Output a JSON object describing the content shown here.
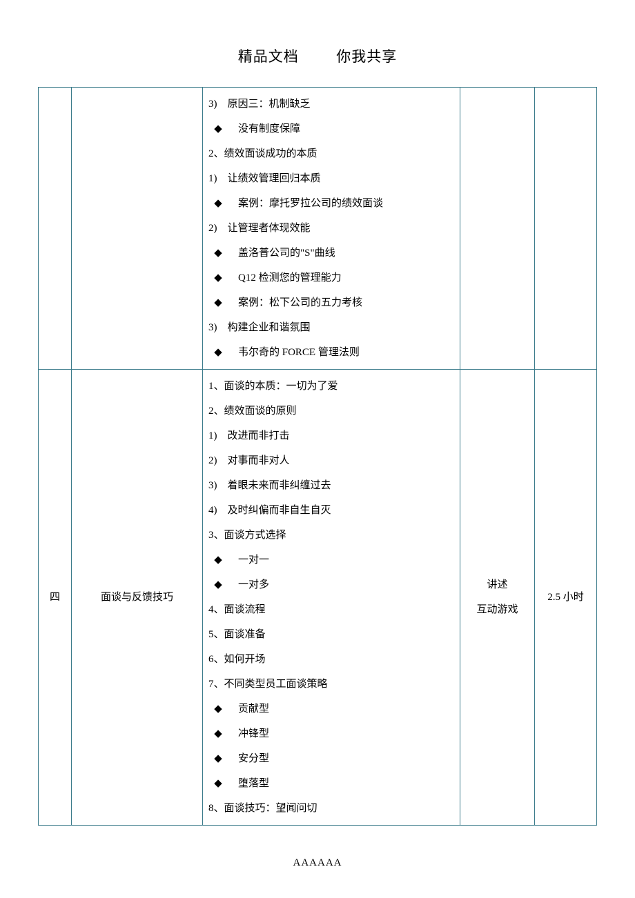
{
  "header": {
    "left": "精品文档",
    "right": "你我共享"
  },
  "footer": "AAAAAA",
  "row1": {
    "lines": [
      {
        "t": "list",
        "text": "3)　原因三：机制缺乏"
      },
      {
        "t": "bullet",
        "text": "没有制度保障"
      },
      {
        "t": "num",
        "text": "2、绩效面谈成功的本质"
      },
      {
        "t": "list",
        "text": "1)　让绩效管理回归本质"
      },
      {
        "t": "bullet",
        "text": "案例：摩托罗拉公司的绩效面谈"
      },
      {
        "t": "list",
        "text": "2)　让管理者体现效能"
      },
      {
        "t": "bullet",
        "text": "盖洛普公司的\"S\"曲线"
      },
      {
        "t": "bullet",
        "text": "Q12 检测您的管理能力"
      },
      {
        "t": "bullet",
        "text": "案例：松下公司的五力考核"
      },
      {
        "t": "list",
        "text": "3)　构建企业和谐氛围"
      },
      {
        "t": "bullet",
        "text": "韦尔奇的 FORCE 管理法则"
      }
    ]
  },
  "row2": {
    "col1": "四",
    "col2": "面谈与反馈技巧",
    "col4_line1": "讲述",
    "col4_line2": "互动游戏",
    "col5": "2.5 小时",
    "lines": [
      {
        "t": "num",
        "text": "1、面谈的本质：一切为了爱"
      },
      {
        "t": "num",
        "text": "2、绩效面谈的原则"
      },
      {
        "t": "list",
        "text": "1)　改进而非打击"
      },
      {
        "t": "list",
        "text": "2)　对事而非对人"
      },
      {
        "t": "list",
        "text": "3)　着眼未来而非纠缠过去"
      },
      {
        "t": "list",
        "text": "4)　及时纠偏而非自生自灭"
      },
      {
        "t": "num",
        "text": "3、面谈方式选择"
      },
      {
        "t": "bullet",
        "text": "一对一"
      },
      {
        "t": "bullet",
        "text": "一对多"
      },
      {
        "t": "num",
        "text": "4、面谈流程"
      },
      {
        "t": "num",
        "text": "5、面谈准备"
      },
      {
        "t": "num",
        "text": "6、如何开场"
      },
      {
        "t": "num",
        "text": "7、不同类型员工面谈策略"
      },
      {
        "t": "bullet",
        "text": "贡献型"
      },
      {
        "t": "bullet",
        "text": "冲锋型"
      },
      {
        "t": "bullet",
        "text": "安分型"
      },
      {
        "t": "bullet",
        "text": "堕落型"
      },
      {
        "t": "num",
        "text": "8、面谈技巧：望闻问切"
      }
    ]
  }
}
